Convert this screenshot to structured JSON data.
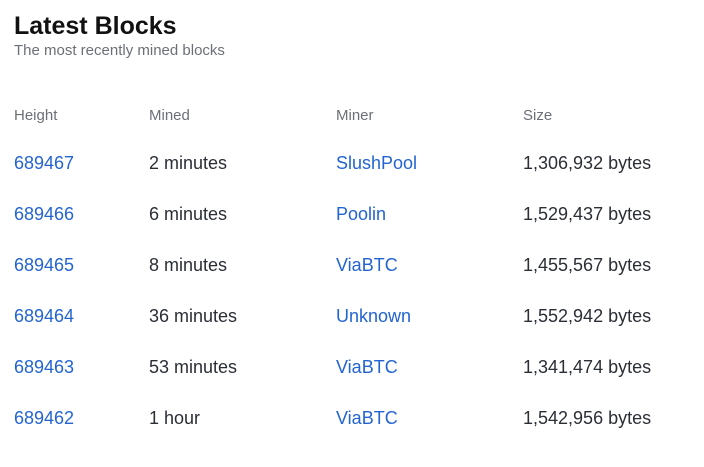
{
  "header": {
    "title": "Latest Blocks",
    "subtitle": "The most recently mined blocks"
  },
  "table": {
    "columns": [
      "Height",
      "Mined",
      "Miner",
      "Size"
    ],
    "rows": [
      {
        "height": "689467",
        "mined": "2 minutes",
        "miner": "SlushPool",
        "size": "1,306,932 bytes"
      },
      {
        "height": "689466",
        "mined": "6 minutes",
        "miner": "Poolin",
        "size": "1,529,437 bytes"
      },
      {
        "height": "689465",
        "mined": "8 minutes",
        "miner": "ViaBTC",
        "size": "1,455,567 bytes"
      },
      {
        "height": "689464",
        "mined": "36 minutes",
        "miner": "Unknown",
        "size": "1,552,942 bytes"
      },
      {
        "height": "689463",
        "mined": "53 minutes",
        "miner": "ViaBTC",
        "size": "1,341,474 bytes"
      },
      {
        "height": "689462",
        "mined": "1 hour",
        "miner": "ViaBTC",
        "size": "1,542,956 bytes"
      }
    ]
  },
  "colors": {
    "link": "#2364d2",
    "text": "#2a2f36",
    "muted": "#6b7078"
  }
}
